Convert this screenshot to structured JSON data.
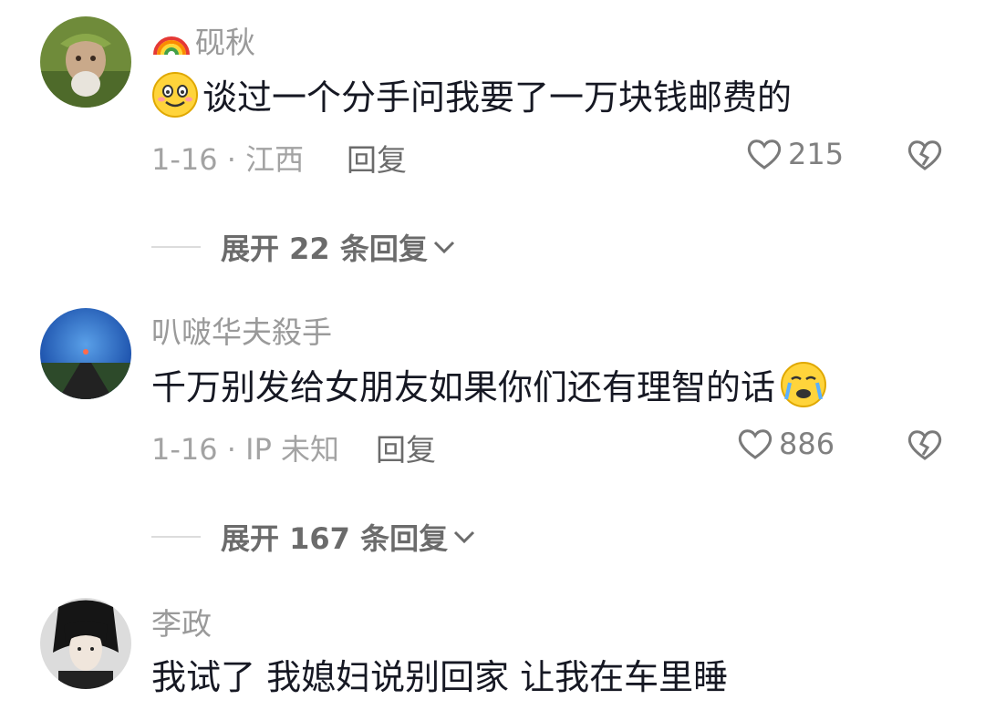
{
  "comments": [
    {
      "username": "砚秋",
      "username_prefix_icon": "rainbow-emoji",
      "content_prefix_icon": "smile-emoji",
      "text": "谈过一个分手问我要了一万块钱邮费的",
      "meta": "1-16 · 江西",
      "reply_label": "回复",
      "likes": "215",
      "expand_label": "展开 22 条回复"
    },
    {
      "username": "叭啵华夫殺手",
      "text": "千万别发给女朋友如果你们还有理智的话",
      "content_suffix_icon": "crying-emoji",
      "meta": "1-16 · IP 未知",
      "reply_label": "回复",
      "likes": "886",
      "expand_label": "展开 167 条回复"
    },
    {
      "username": "李政",
      "text": "我试了 我媳妇说别回家 让我在车里睡"
    }
  ],
  "colors": {
    "text_primary": "#161823",
    "text_secondary": "#9a9a9a",
    "icon_gray": "#8a8a8a"
  }
}
